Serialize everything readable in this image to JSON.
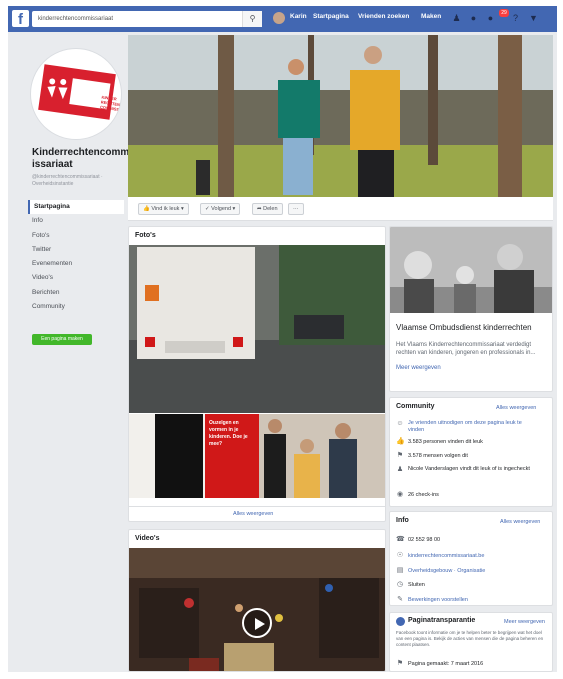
{
  "topbar": {
    "search_value": "kinderrechtencommissariaat",
    "user_name": "Karin",
    "nav_home": "Startpagina",
    "nav_find_friends": "Vrienden zoeken",
    "nav_create": "Maken",
    "notification_count": "29"
  },
  "page": {
    "name": "Kinderrechtencomm issariaat",
    "handle": "@kinderrechtencommissariaat · Overheidsinstantie",
    "logo_text": "KINDER RECHTEN COMMISSARIAAT"
  },
  "left_nav": {
    "items": [
      "Startpagina",
      "Info",
      "Foto's",
      "Twitter",
      "Evenementen",
      "Video's",
      "Berichten",
      "Community"
    ],
    "create_button": "Een pagina maken"
  },
  "actionbar": {
    "liked": "Vind ik leuk",
    "following": "Volgend",
    "share": "Delen",
    "more": "···"
  },
  "photos_card": {
    "title": "Foto's",
    "see_all": "Alles weergeven",
    "poster_text": "Ouzelgen en vormen in je kinderen. Doe je mee?"
  },
  "videos_card": {
    "title": "Video's"
  },
  "about_card": {
    "title": "Vlaamse Ombudsdienst kinderrechten",
    "text": "Het Vlaams Kinderrechtencommissariaat verdedigt rechten van kinderen, jongeren en professionals in...",
    "more": "Meer weergeven"
  },
  "community_card": {
    "title": "Community",
    "see_all": "Alles weergeven",
    "rows": [
      "Je vrienden uitnodigen om deze pagina leuk te vinden",
      "3.583 personen vinden dit leuk",
      "3.578 mensen volgen dit",
      "Nicole Vanderslagen vindt dit leuk of is ingecheckt",
      "26 check-ins"
    ]
  },
  "info_card": {
    "title": "Info",
    "see_all": "Alles weergeven",
    "rows": [
      "02 552 98 00",
      "kinderrechtencommissariaat.be",
      "Overheidsgebouw · Organisatie",
      "Sluiten",
      "Bewerkingen voorstellen"
    ]
  },
  "transparency_card": {
    "title": "Paginatransparantie",
    "see_more": "Meer weergeven",
    "text": "Facebook toont informatie om je te helpen beter te begrijpen wat het doel van een pagina is. Bekijk de acties van mensen die de pagina beheren en content plaatsen.",
    "created": "Pagina gemaakt: 7 maart 2016"
  },
  "colors": {
    "facebook_blue": "#4267b2",
    "page_background": "#e9ebee",
    "brand_red": "#d8202e",
    "create_green": "#42b72a"
  }
}
